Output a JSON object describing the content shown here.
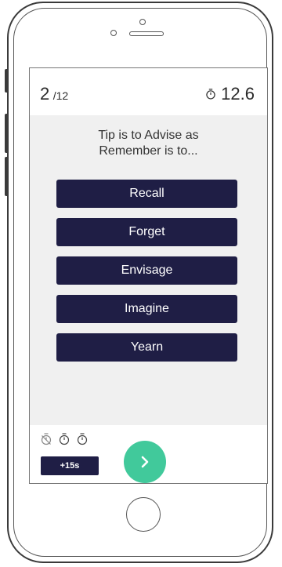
{
  "header": {
    "progress_current": "2",
    "progress_total": "/12",
    "timer_value": "12.6"
  },
  "question": {
    "line1": "Tip is to Advise as",
    "line2": "Remember is to..."
  },
  "answers": [
    "Recall",
    "Forget",
    "Envisage",
    "Imagine",
    "Yearn"
  ],
  "footer": {
    "bonus_label": "+15s",
    "powerup_icons": [
      "timer-disabled-icon",
      "timer-icon",
      "timer-icon"
    ]
  },
  "colors": {
    "answer_bg": "#1f1e45",
    "next_btn": "#41c99b",
    "question_bg": "#f0f0f0"
  }
}
